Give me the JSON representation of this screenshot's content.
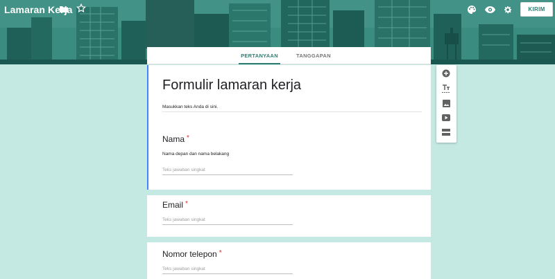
{
  "app": {
    "title": "Lamaran Kerja"
  },
  "header": {
    "icons": [
      "folder-icon",
      "star-icon",
      "palette-icon",
      "eye-icon",
      "gear-icon"
    ],
    "send_label": "KIRIM"
  },
  "tabs": [
    {
      "label": "PERTANYAAN",
      "active": true
    },
    {
      "label": "TANGGAPAN",
      "active": false
    }
  ],
  "form": {
    "title": "Formulir lamaran kerja",
    "description": "Masukkan teks Anda di sini."
  },
  "questions": [
    {
      "label": "Nama",
      "required": "*",
      "help": "Nama depan dan nama belakang",
      "placeholder": "Teks jawaban singkat"
    },
    {
      "label": "Email",
      "required": "*",
      "placeholder": "Teks jawaban singkat"
    },
    {
      "label": "Nomor telepon",
      "required": "*",
      "placeholder": "Teks jawaban singkat"
    }
  ],
  "toolbar": {
    "tools": [
      "add-question-icon",
      "title-text-icon",
      "image-icon",
      "video-icon",
      "section-icon"
    ]
  },
  "colors": {
    "accent": "#2f7d72",
    "background": "#c4e9e3",
    "required": "#d93025",
    "active_bar": "#4285f4"
  }
}
